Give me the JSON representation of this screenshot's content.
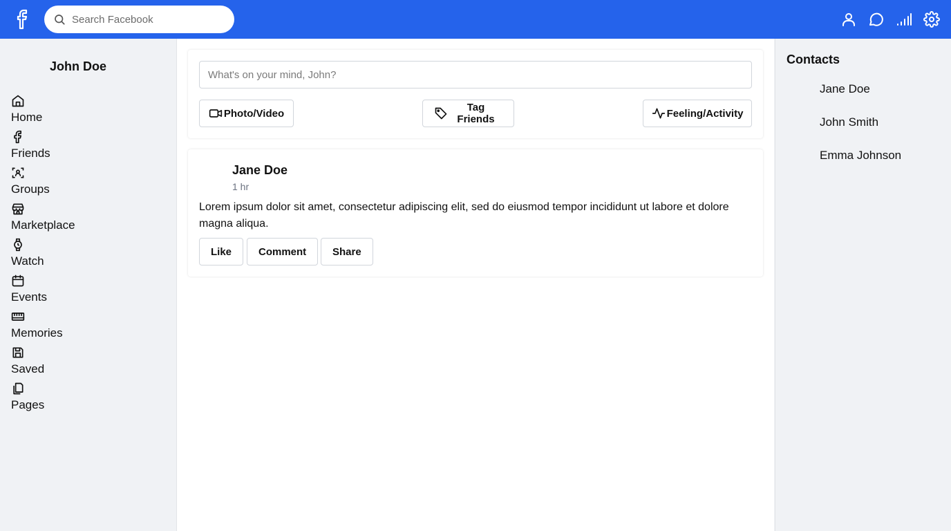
{
  "header": {
    "logo_icon": "facebook-icon",
    "search_placeholder": "Search Facebook",
    "icons": [
      "person-icon",
      "chat-bubble-icon",
      "signal-icon",
      "gear-icon"
    ],
    "accent_color": "#2563eb"
  },
  "sidebar": {
    "user_name": "John Doe",
    "items": [
      {
        "label": "Home",
        "icon": "home-icon"
      },
      {
        "label": "Friends",
        "icon": "facebook-icon"
      },
      {
        "label": "Groups",
        "icon": "groups-scan-icon"
      },
      {
        "label": "Marketplace",
        "icon": "store-icon"
      },
      {
        "label": "Watch",
        "icon": "watch-icon"
      },
      {
        "label": "Events",
        "icon": "calendar-icon"
      },
      {
        "label": "Memories",
        "icon": "film-strip-icon"
      },
      {
        "label": "Saved",
        "icon": "save-icon"
      },
      {
        "label": "Pages",
        "icon": "pages-icon"
      }
    ]
  },
  "composer": {
    "placeholder": "What's on your mind, John?",
    "photo_label": "Photo/Video",
    "tag_label": "Tag Friends",
    "feeling_label": "Feeling/Activity"
  },
  "post": {
    "author": "Jane Doe",
    "time": "1 hr",
    "text": "Lorem ipsum dolor sit amet, consectetur adipiscing elit, sed do eiusmod tempor incididunt ut labore et dolore magna aliqua.",
    "like_label": "Like",
    "comment_label": "Comment",
    "share_label": "Share"
  },
  "contacts": {
    "title": "Contacts",
    "people": [
      "Jane Doe",
      "John Smith",
      "Emma Johnson"
    ]
  }
}
